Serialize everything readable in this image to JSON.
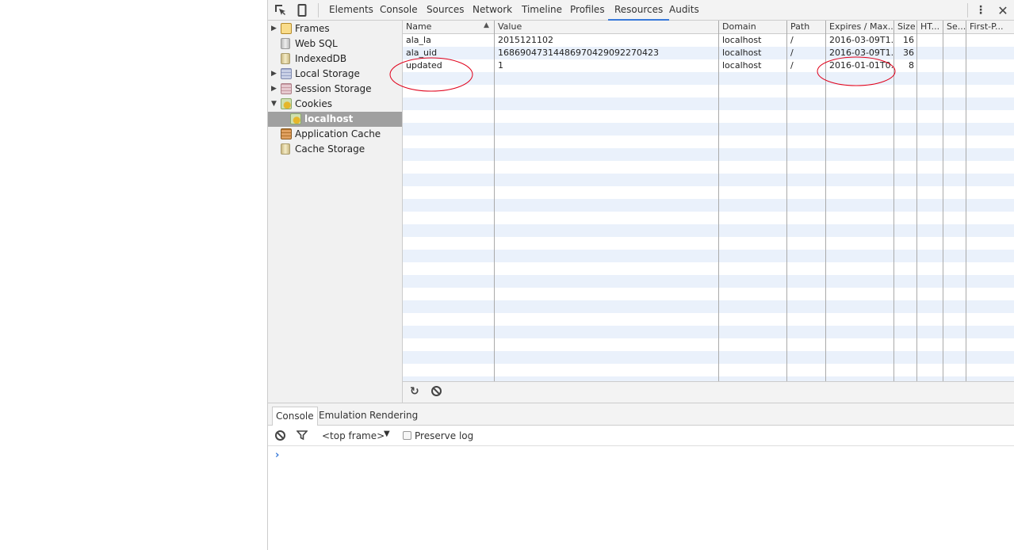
{
  "toolbar": {
    "tabs": [
      "Elements",
      "Console",
      "Sources",
      "Network",
      "Timeline",
      "Profiles",
      "Resources",
      "Audits"
    ],
    "active_tab": "Resources",
    "icons": [
      "inspect-icon",
      "device-icon",
      "more-icon",
      "close-icon"
    ]
  },
  "sidebar": {
    "items": [
      {
        "label": "Frames",
        "icon": "folder-icon",
        "expandable": true,
        "expanded": false
      },
      {
        "label": "Web SQL",
        "icon": "database-icon"
      },
      {
        "label": "IndexedDB",
        "icon": "database-icon"
      },
      {
        "label": "Local Storage",
        "icon": "table-icon",
        "expandable": true,
        "expanded": false
      },
      {
        "label": "Session Storage",
        "icon": "table-icon",
        "expandable": true,
        "expanded": false
      },
      {
        "label": "Cookies",
        "icon": "cookie-icon",
        "expandable": true,
        "expanded": true
      },
      {
        "label": "localhost",
        "icon": "cookie-icon",
        "selected": true
      },
      {
        "label": "Application Cache",
        "icon": "app-cache-icon"
      },
      {
        "label": "Cache Storage",
        "icon": "database-icon"
      }
    ]
  },
  "cookies": {
    "columns": [
      "Name",
      "Value",
      "Domain",
      "Path",
      "Expires / Max...",
      "Size",
      "HT...",
      "Se...",
      "First-P..."
    ],
    "sorted_column": "Name",
    "sort_direction": "ascending",
    "rows": [
      [
        "ala_la",
        "2015121102",
        "localhost",
        "/",
        "2016-03-09T1...",
        "16",
        "",
        "",
        ""
      ],
      [
        "ala_uid",
        "16869047314486970429092270423",
        "localhost",
        "/",
        "2016-03-09T1...",
        "36",
        "",
        "",
        ""
      ],
      [
        "updated",
        "1",
        "localhost",
        "/",
        "2016-01-01T0...",
        "8",
        "",
        "",
        ""
      ]
    ],
    "footer_icons": [
      "refresh-icon",
      "clear-icon"
    ]
  },
  "drawer": {
    "tabs": [
      "Console",
      "Emulation",
      "Rendering"
    ],
    "active_tab": "Console",
    "frame_select": "<top frame>",
    "preserve_log_label": "Preserve log",
    "preserve_log": false,
    "prompt": "›"
  },
  "colors": {
    "accent": "#3879d9",
    "annotation": "#e0001a",
    "row_stripe": "#eaf1fb",
    "selected": "#a0a0a0"
  }
}
